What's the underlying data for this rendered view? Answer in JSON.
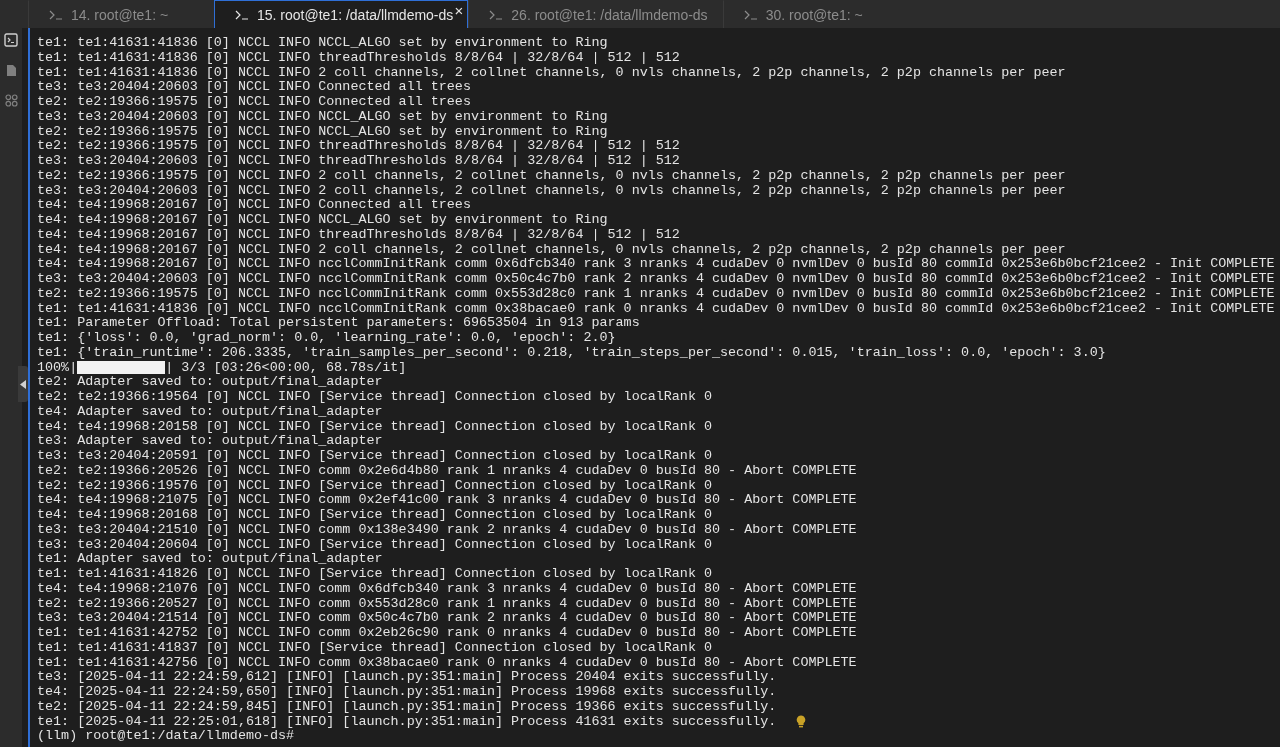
{
  "tabs": [
    {
      "label": "14. root@te1: ~",
      "selected": false
    },
    {
      "label": "15. root@te1: /data/llmdemo-ds",
      "selected": true,
      "close": "×"
    },
    {
      "label": "26. root@te1: /data/llmdemo-ds",
      "selected": false
    },
    {
      "label": "30. root@te1: ~",
      "selected": false
    }
  ],
  "sidebar": {
    "items": [
      {
        "kind": "terminal",
        "selected": true
      },
      {
        "kind": "file",
        "selected": false
      },
      {
        "kind": "grid",
        "selected": false
      }
    ]
  },
  "terminal": {
    "lines": [
      {
        "kind": "text",
        "text": "te1: te1:41631:41836 [0] NCCL INFO NCCL_ALGO set by environment to Ring"
      },
      {
        "kind": "text",
        "text": "te1: te1:41631:41836 [0] NCCL INFO threadThresholds 8/8/64 | 32/8/64 | 512 | 512"
      },
      {
        "kind": "text",
        "text": "te1: te1:41631:41836 [0] NCCL INFO 2 coll channels, 2 collnet channels, 0 nvls channels, 2 p2p channels, 2 p2p channels per peer"
      },
      {
        "kind": "text",
        "text": "te3: te3:20404:20603 [0] NCCL INFO Connected all trees"
      },
      {
        "kind": "text",
        "text": "te2: te2:19366:19575 [0] NCCL INFO Connected all trees"
      },
      {
        "kind": "text",
        "text": "te3: te3:20404:20603 [0] NCCL INFO NCCL_ALGO set by environment to Ring"
      },
      {
        "kind": "text",
        "text": "te2: te2:19366:19575 [0] NCCL INFO NCCL_ALGO set by environment to Ring"
      },
      {
        "kind": "text",
        "text": "te2: te2:19366:19575 [0] NCCL INFO threadThresholds 8/8/64 | 32/8/64 | 512 | 512"
      },
      {
        "kind": "text",
        "text": "te3: te3:20404:20603 [0] NCCL INFO threadThresholds 8/8/64 | 32/8/64 | 512 | 512"
      },
      {
        "kind": "text",
        "text": "te2: te2:19366:19575 [0] NCCL INFO 2 coll channels, 2 collnet channels, 0 nvls channels, 2 p2p channels, 2 p2p channels per peer"
      },
      {
        "kind": "text",
        "text": "te3: te3:20404:20603 [0] NCCL INFO 2 coll channels, 2 collnet channels, 0 nvls channels, 2 p2p channels, 2 p2p channels per peer"
      },
      {
        "kind": "text",
        "text": "te4: te4:19968:20167 [0] NCCL INFO Connected all trees"
      },
      {
        "kind": "text",
        "text": "te4: te4:19968:20167 [0] NCCL INFO NCCL_ALGO set by environment to Ring"
      },
      {
        "kind": "text",
        "text": "te4: te4:19968:20167 [0] NCCL INFO threadThresholds 8/8/64 | 32/8/64 | 512 | 512"
      },
      {
        "kind": "text",
        "text": "te4: te4:19968:20167 [0] NCCL INFO 2 coll channels, 2 collnet channels, 0 nvls channels, 2 p2p channels, 2 p2p channels per peer"
      },
      {
        "kind": "text",
        "text": "te4: te4:19968:20167 [0] NCCL INFO ncclCommInitRank comm 0x6dfcb340 rank 3 nranks 4 cudaDev 0 nvmlDev 0 busId 80 commId 0x253e6b0bcf21cee2 - Init COMPLETE"
      },
      {
        "kind": "text",
        "text": "te3: te3:20404:20603 [0] NCCL INFO ncclCommInitRank comm 0x50c4c7b0 rank 2 nranks 4 cudaDev 0 nvmlDev 0 busId 80 commId 0x253e6b0bcf21cee2 - Init COMPLETE"
      },
      {
        "kind": "text",
        "text": "te2: te2:19366:19575 [0] NCCL INFO ncclCommInitRank comm 0x553d28c0 rank 1 nranks 4 cudaDev 0 nvmlDev 0 busId 80 commId 0x253e6b0bcf21cee2 - Init COMPLETE"
      },
      {
        "kind": "text",
        "text": "te1: te1:41631:41836 [0] NCCL INFO ncclCommInitRank comm 0x38bacae0 rank 0 nranks 4 cudaDev 0 nvmlDev 0 busId 80 commId 0x253e6b0bcf21cee2 - Init COMPLETE"
      },
      {
        "kind": "text",
        "text": "te1: Parameter Offload: Total persistent parameters: 69653504 in 913 params"
      },
      {
        "kind": "text",
        "text": "te1: {'loss': 0.0, 'grad_norm': 0.0, 'learning_rate': 0.0, 'epoch': 2.0}"
      },
      {
        "kind": "text",
        "text": "te1: {'train_runtime': 206.3335, 'train_samples_per_second': 0.218, 'train_steps_per_second': 0.015, 'train_loss': 0.0, 'epoch': 3.0}"
      },
      {
        "kind": "progress",
        "prefix": "100%|",
        "level": 1,
        "suffix": "| 3/3 [03:26<00:00, 68.78s/it]"
      },
      {
        "kind": "text",
        "text": "te2: Adapter saved to: output/final_adapter"
      },
      {
        "kind": "text",
        "text": "te2: te2:19366:19564 [0] NCCL INFO [Service thread] Connection closed by localRank 0"
      },
      {
        "kind": "text",
        "text": "te4: Adapter saved to: output/final_adapter"
      },
      {
        "kind": "text",
        "text": "te4: te4:19968:20158 [0] NCCL INFO [Service thread] Connection closed by localRank 0"
      },
      {
        "kind": "text",
        "text": "te3: Adapter saved to: output/final_adapter"
      },
      {
        "kind": "text",
        "text": "te3: te3:20404:20591 [0] NCCL INFO [Service thread] Connection closed by localRank 0"
      },
      {
        "kind": "text",
        "text": "te2: te2:19366:20526 [0] NCCL INFO comm 0x2e6d4b80 rank 1 nranks 4 cudaDev 0 busId 80 - Abort COMPLETE"
      },
      {
        "kind": "text",
        "text": "te2: te2:19366:19576 [0] NCCL INFO [Service thread] Connection closed by localRank 0"
      },
      {
        "kind": "text",
        "text": "te4: te4:19968:21075 [0] NCCL INFO comm 0x2ef41c00 rank 3 nranks 4 cudaDev 0 busId 80 - Abort COMPLETE"
      },
      {
        "kind": "text",
        "text": "te4: te4:19968:20168 [0] NCCL INFO [Service thread] Connection closed by localRank 0"
      },
      {
        "kind": "text",
        "text": "te3: te3:20404:21510 [0] NCCL INFO comm 0x138e3490 rank 2 nranks 4 cudaDev 0 busId 80 - Abort COMPLETE"
      },
      {
        "kind": "text",
        "text": "te3: te3:20404:20604 [0] NCCL INFO [Service thread] Connection closed by localRank 0"
      },
      {
        "kind": "text",
        "text": "te1: Adapter saved to: output/final_adapter"
      },
      {
        "kind": "text",
        "text": "te1: te1:41631:41826 [0] NCCL INFO [Service thread] Connection closed by localRank 0"
      },
      {
        "kind": "text",
        "text": "te4: te4:19968:21076 [0] NCCL INFO comm 0x6dfcb340 rank 3 nranks 4 cudaDev 0 busId 80 - Abort COMPLETE"
      },
      {
        "kind": "text",
        "text": "te2: te2:19366:20527 [0] NCCL INFO comm 0x553d28c0 rank 1 nranks 4 cudaDev 0 busId 80 - Abort COMPLETE"
      },
      {
        "kind": "text",
        "text": "te3: te3:20404:21514 [0] NCCL INFO comm 0x50c4c7b0 rank 2 nranks 4 cudaDev 0 busId 80 - Abort COMPLETE"
      },
      {
        "kind": "text",
        "text": "te1: te1:41631:42752 [0] NCCL INFO comm 0x2eb26c90 rank 0 nranks 4 cudaDev 0 busId 80 - Abort COMPLETE"
      },
      {
        "kind": "text",
        "text": "te1: te1:41631:41837 [0] NCCL INFO [Service thread] Connection closed by localRank 0"
      },
      {
        "kind": "text",
        "text": "te1: te1:41631:42756 [0] NCCL INFO comm 0x38bacae0 rank 0 nranks 4 cudaDev 0 busId 80 - Abort COMPLETE"
      },
      {
        "kind": "text",
        "text": "te3: [2025-04-11 22:24:59,612] [INFO] [launch.py:351:main] Process 20404 exits successfully."
      },
      {
        "kind": "text",
        "text": "te4: [2025-04-11 22:24:59,650] [INFO] [launch.py:351:main] Process 19968 exits successfully."
      },
      {
        "kind": "text",
        "text": "te2: [2025-04-11 22:24:59,845] [INFO] [launch.py:351:main] Process 19366 exits successfully."
      },
      {
        "kind": "hinted",
        "text": "te1: [2025-04-11 22:25:01,618] [INFO] [launch.py:351:main] Process 41631 exits successfully."
      },
      {
        "kind": "prompt",
        "text": "(llm) root@te1:/data/llmdemo-ds#"
      }
    ]
  }
}
